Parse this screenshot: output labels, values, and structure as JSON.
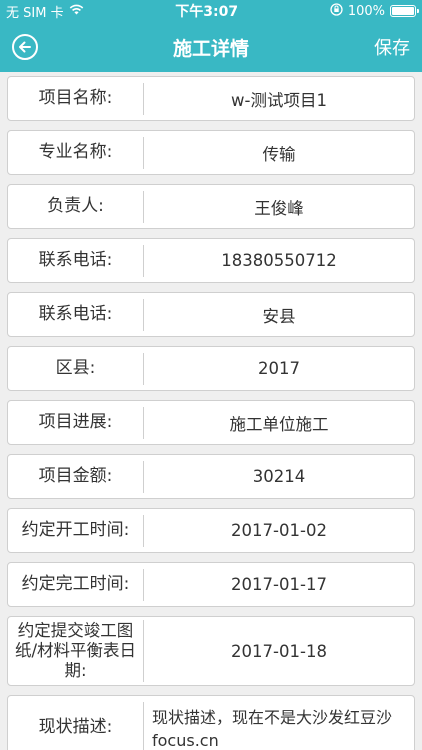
{
  "status_bar": {
    "carrier": "无 SIM 卡",
    "time": "下午3:07",
    "battery": "100%",
    "battery_level": 1.0
  },
  "nav": {
    "title": "施工详情",
    "save_label": "保存"
  },
  "fields": [
    {
      "label": "项目名称:",
      "value": "w-测试项目1"
    },
    {
      "label": "专业名称:",
      "value": "传输"
    },
    {
      "label": "负责人:",
      "value": "王俊峰"
    },
    {
      "label": "联系电话:",
      "value": "18380550712"
    },
    {
      "label": "联系电话:",
      "value": "安县"
    },
    {
      "label": "区县:",
      "value": "2017"
    },
    {
      "label": "项目进展:",
      "value": "施工单位施工"
    },
    {
      "label": "项目金额:",
      "value": "30214"
    },
    {
      "label": "约定开工时间:",
      "value": "2017-01-02"
    },
    {
      "label": "约定完工时间:",
      "value": "2017-01-17"
    },
    {
      "label": "约定提交竣工图纸/材料平衡表日期:",
      "value": "2017-01-18"
    },
    {
      "label": "现状描述:",
      "value": "现状描述，现在不是大沙发红豆沙focus.cn"
    }
  ]
}
